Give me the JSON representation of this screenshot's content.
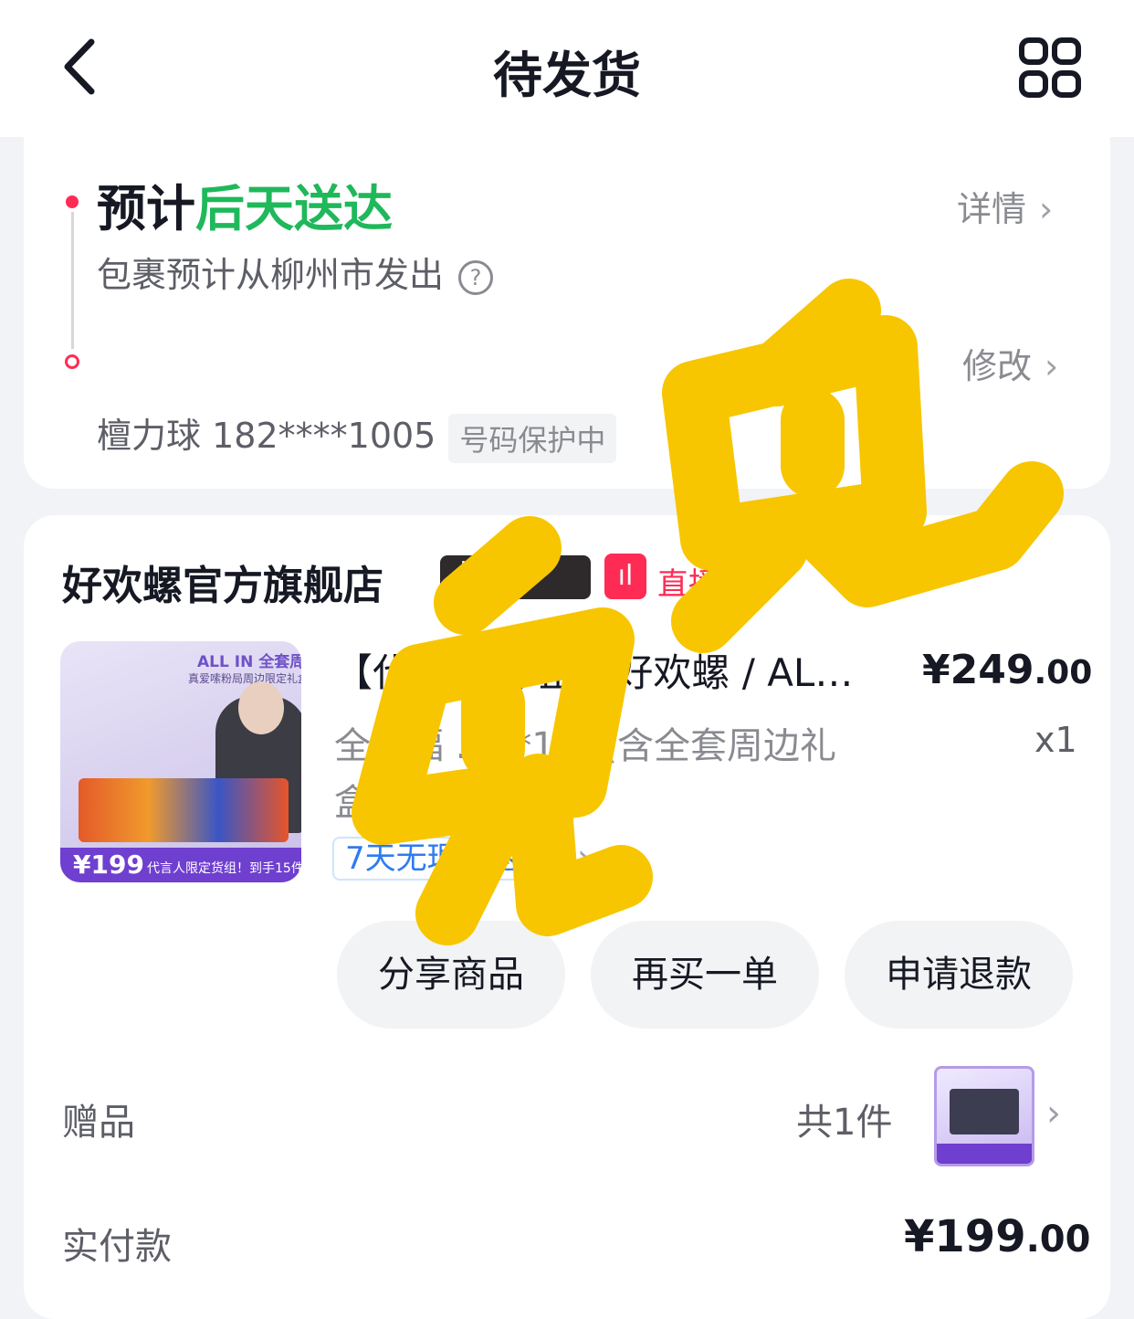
{
  "header": {
    "title": "待发货",
    "back_icon": "chevron-left-icon",
    "menu_icon": "grid-icon"
  },
  "shipping": {
    "eta_prefix": "预计",
    "eta_highlight": "后天送达",
    "detail_link": "详情",
    "origin": "包裹预计从柳州市发出",
    "edit_link": "修改",
    "receiver_name": "檀力球",
    "receiver_phone": "182****1005",
    "phone_protect": "号码保护中"
  },
  "store": {
    "name": "好欢螺官方旗舰店",
    "platform_badge": "抖",
    "live_label": "直播"
  },
  "product": {
    "thumb_banner": "ALL IN 全套周边",
    "thumb_sub": "真爱嗦粉局周边限定礼盒",
    "thumb_price": "¥199",
    "thumb_text": "代言人限定货组！到手15件",
    "title": "【代言人货组】 好欢螺 / AL…",
    "spec": "全家福 ...g*1件 (含全套周边礼盒)",
    "price_main": "¥249",
    "price_decimal": ".00",
    "qty": "x1",
    "return_tag": "7天无理由退货"
  },
  "actions": {
    "share": "分享商品",
    "rebuy": "再买一单",
    "refund": "申请退款"
  },
  "gift": {
    "label": "赠品",
    "count": "共1件"
  },
  "payment": {
    "label": "实付款",
    "amount_main": "¥199",
    "amount_decimal": ".00"
  },
  "colors": {
    "accent_red": "#fe2c55",
    "eta_green": "#1fb85a",
    "overlay_yellow": "#f7c600",
    "link_blue": "#2e7bf0"
  }
}
